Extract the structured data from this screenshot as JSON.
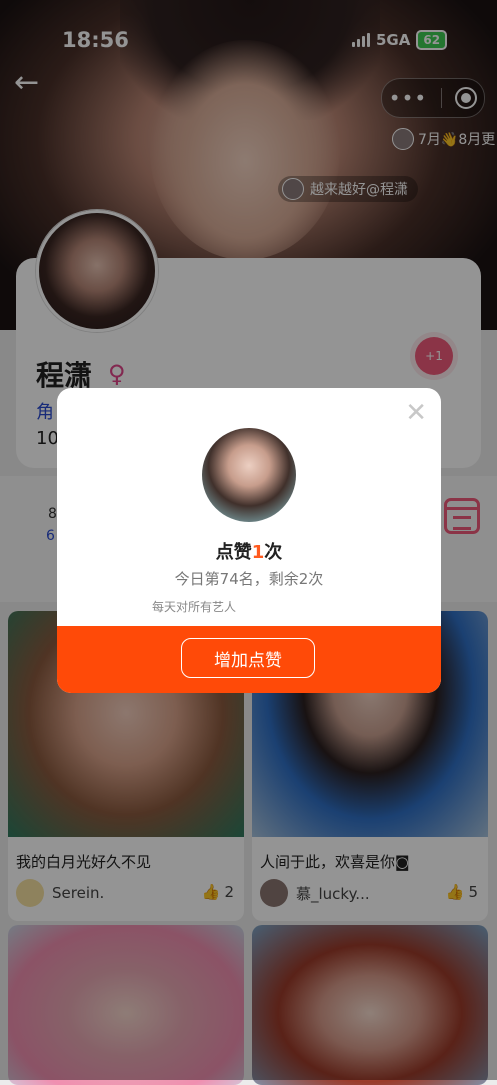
{
  "status_bar": {
    "time": "18:56",
    "network": "5GA",
    "battery": "62"
  },
  "header": {
    "month_tag": "7月👋8月更",
    "credit": "越来越好@程潇"
  },
  "profile": {
    "name": "程潇",
    "role_text": "角",
    "fans_text": "10",
    "like_badge": "+1"
  },
  "stats": {
    "line1": "8",
    "line2": "6"
  },
  "posts": [
    {
      "title": "我的白月光好久不见",
      "user": "Serein.",
      "likes": "2"
    },
    {
      "title": "人间于此，欢喜是你◙",
      "user": "慕_lucky...",
      "likes": "5"
    }
  ],
  "modal": {
    "title_prefix": "点赞",
    "title_count": "1",
    "title_suffix": "次",
    "rank_text": "今日第74名，剩余2次",
    "note_text": "每天对所有艺人",
    "button_label": "增加点赞",
    "close_symbol": "✕"
  },
  "colors": {
    "accent": "#ff4a08",
    "like_pink": "#f05a7a",
    "link_blue": "#2a4bd0"
  }
}
